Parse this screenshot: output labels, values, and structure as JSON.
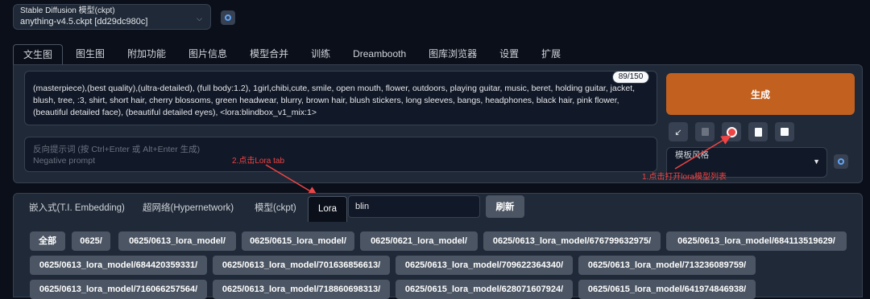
{
  "model": {
    "label": "Stable Diffusion 模型(ckpt)",
    "value": "anything-v4.5.ckpt [dd29dc980c]"
  },
  "tabs": [
    "文生图",
    "图生图",
    "附加功能",
    "图片信息",
    "模型合并",
    "训练",
    "Dreambooth",
    "图库浏览器",
    "设置",
    "扩展"
  ],
  "prompt": {
    "text": "(masterpiece),(best quality),(ultra-detailed), (full body:1.2), 1girl,chibi,cute, smile, open mouth, flower, outdoors, playing guitar, music, beret, holding guitar, jacket, blush, tree, :3, shirt, short hair, cherry blossoms, green headwear, blurry, brown hair, blush stickers, long sleeves, bangs, headphones, black hair, pink flower, (beautiful detailed face), (beautiful detailed eyes), <lora:blindbox_v1_mix:1>",
    "counter": "89/150"
  },
  "negative": {
    "placeholder_line1": "反向提示词 (按 Ctrl+Enter 或 Alt+Enter 生成)",
    "placeholder_line2": "Negative prompt"
  },
  "generate_label": "生成",
  "style_label": "模板风格",
  "annotations": {
    "lora_tab_hint": "2.点击Lora tab",
    "open_list_hint": "1.点击打开lora模型列表",
    "color": "#ef4444"
  },
  "subtabs": {
    "embedding": "嵌入式(T.I. Embedding)",
    "hypernetwork": "超网络(Hypernetwork)",
    "checkpoint": "模型(ckpt)",
    "lora": "Lora"
  },
  "search_value": "blin",
  "refresh_label": "刷新",
  "chips": [
    "全部",
    "0625/",
    "0625/0613_lora_model/",
    "0625/0615_lora_model/",
    "0625/0621_lora_model/",
    "0625/0613_lora_model/676799632975/",
    "0625/0613_lora_model/684113519629/",
    "0625/0613_lora_model/684420359331/",
    "0625/0613_lora_model/701636856613/",
    "0625/0613_lora_model/709622364340/",
    "0625/0613_lora_model/713236089759/",
    "0625/0613_lora_model/716066257564/",
    "0625/0613_lora_model/718860698313/",
    "0625/0615_lora_model/628071607924/",
    "0625/0615_lora_model/641974846938/"
  ],
  "colors": {
    "background": "#0b0f19",
    "panel": "#1f2937",
    "generate": "#c2611f",
    "chip": "#4b5563"
  }
}
